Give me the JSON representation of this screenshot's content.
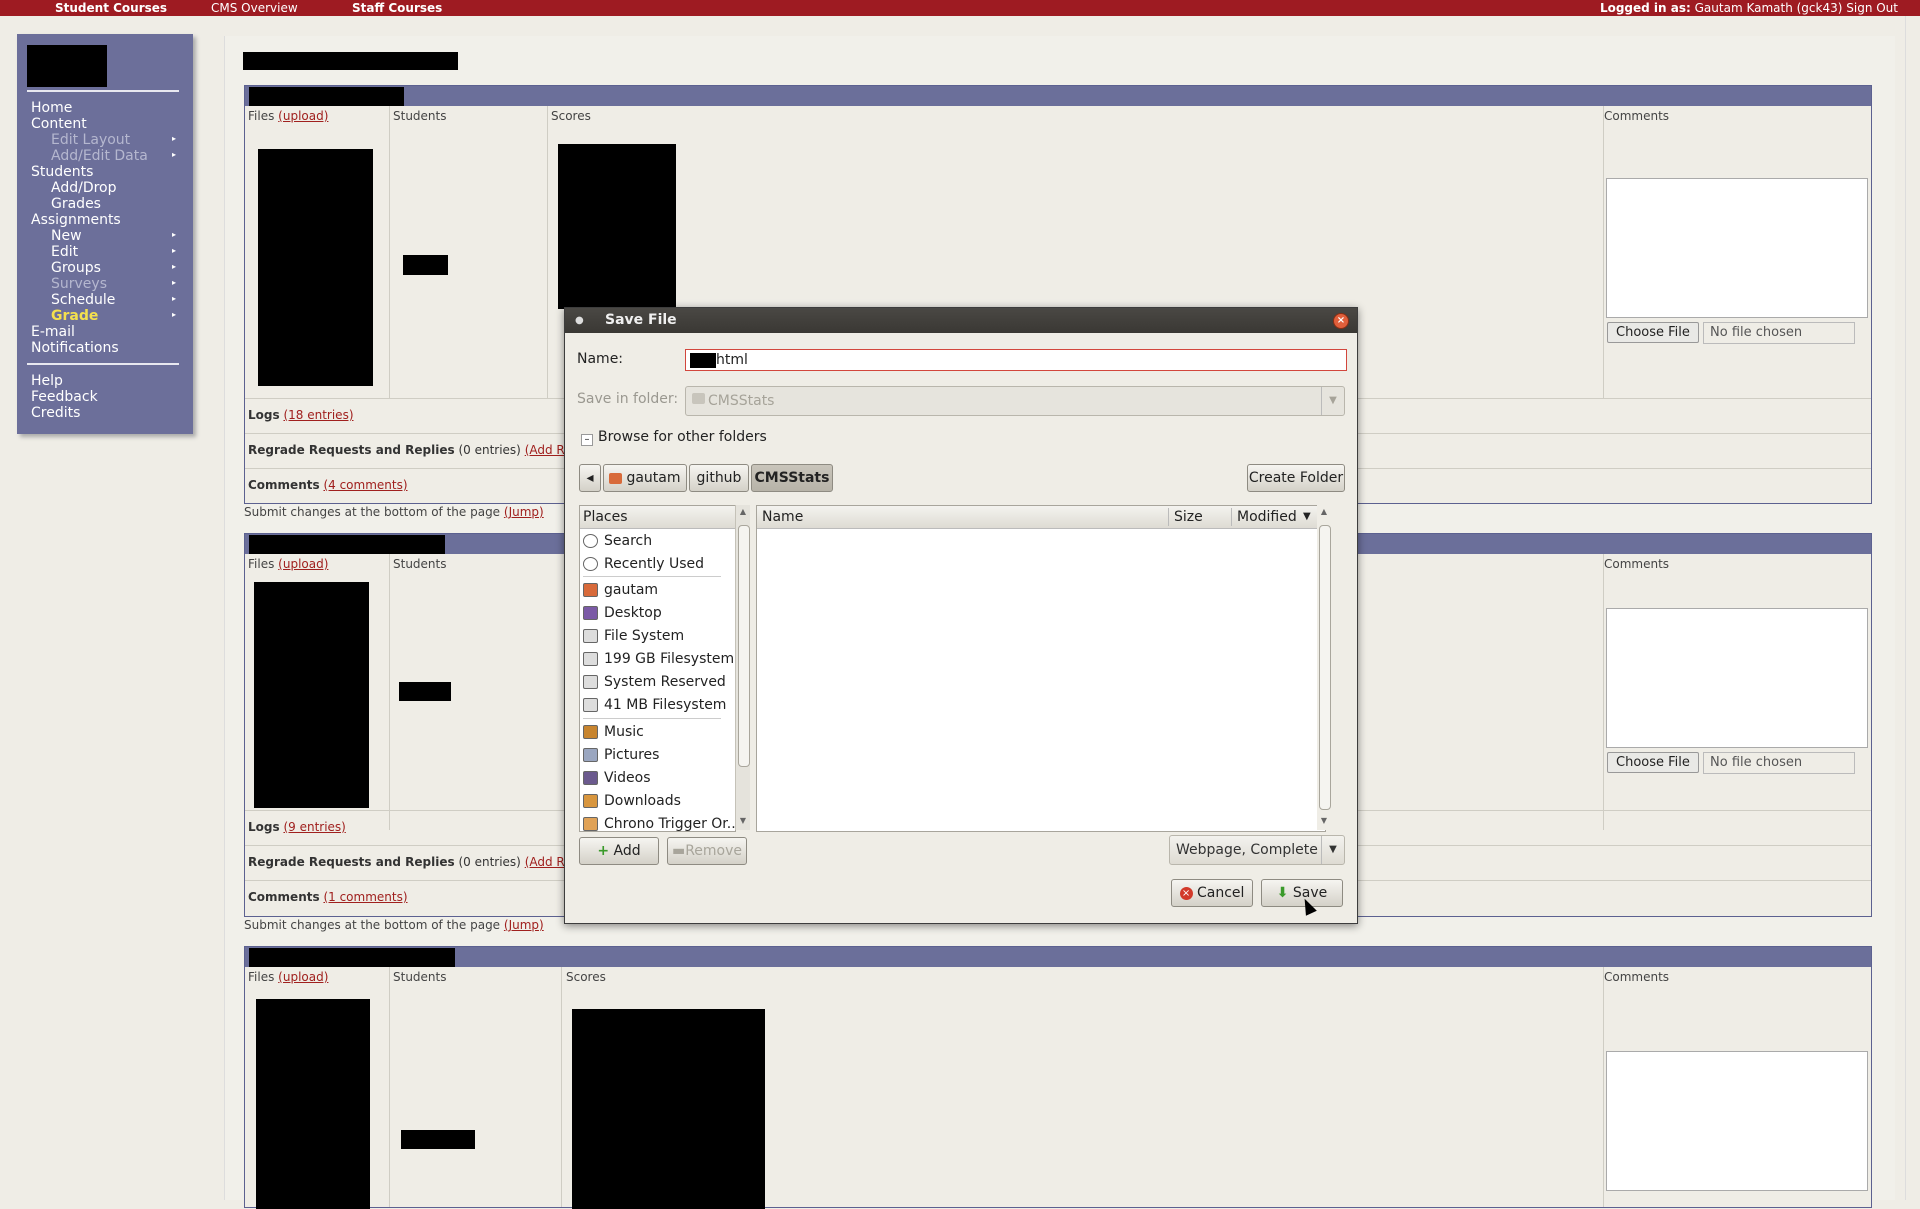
{
  "topbar": {
    "student_courses": "Student Courses",
    "cms_overview": "CMS Overview",
    "staff_courses": "Staff Courses",
    "logged_in_label": "Logged in as:",
    "user": "Gautam Kamath (gck43)",
    "sign_out": "Sign Out"
  },
  "sidebar": {
    "home": "Home",
    "content": "Content",
    "edit_layout": "Edit Layout",
    "add_edit_data": "Add/Edit Data",
    "students": "Students",
    "add_drop": "Add/Drop",
    "grades": "Grades",
    "assignments": "Assignments",
    "new": "New",
    "edit": "Edit",
    "groups": "Groups",
    "surveys": "Surveys",
    "schedule": "Schedule",
    "grade": "Grade",
    "email": "E-mail",
    "notifications": "Notifications",
    "help": "Help",
    "feedback": "Feedback",
    "credits": "Credits"
  },
  "columns": {
    "files": "Files",
    "upload": "(upload)",
    "students": "Students",
    "scores": "Scores",
    "comments": "Comments"
  },
  "panels": [
    {
      "logs_label": "Logs",
      "logs_count": "(18 entries)",
      "regrade_label": "Regrade Requests and Replies",
      "regrade_count": "(0 entries)",
      "add_request": "(Add Request)",
      "comments_label": "Comments",
      "comments_count": "(4 comments)"
    },
    {
      "logs_label": "Logs",
      "logs_count": "(9 entries)",
      "regrade_label": "Regrade Requests and Replies",
      "regrade_count": "(0 entries)",
      "add_request": "(Add Request)",
      "comments_label": "Comments",
      "comments_count": "(1 comments)"
    }
  ],
  "submit_note": "Submit changes at the bottom of the page",
  "jump": "(Jump)",
  "file_input": {
    "choose": "Choose File",
    "status": "No file chosen"
  },
  "dialog": {
    "title": "Save File",
    "name_label": "Name:",
    "name_value": "html",
    "save_in_label": "Save in folder:",
    "save_in_value": "CMSStats",
    "browse_label": "Browse for other folders",
    "breadcrumbs": [
      "gautam",
      "github",
      "CMSStats"
    ],
    "create_folder": "Create Folder",
    "places_header": "Places",
    "places": [
      {
        "label": "Search",
        "icon": "search-icon"
      },
      {
        "label": "Recently Used",
        "icon": "clock-icon"
      },
      {
        "label": "gautam",
        "icon": "home-folder-icon"
      },
      {
        "label": "Desktop",
        "icon": "desktop-icon"
      },
      {
        "label": "File System",
        "icon": "drive-icon"
      },
      {
        "label": "199 GB Filesystem",
        "icon": "drive-icon"
      },
      {
        "label": "System Reserved",
        "icon": "drive-icon"
      },
      {
        "label": "41 MB Filesystem",
        "icon": "drive-icon"
      },
      {
        "label": "Music",
        "icon": "music-folder-icon"
      },
      {
        "label": "Pictures",
        "icon": "pictures-folder-icon"
      },
      {
        "label": "Videos",
        "icon": "videos-folder-icon"
      },
      {
        "label": "Downloads",
        "icon": "downloads-folder-icon"
      },
      {
        "label": "Chrono Trigger Or...",
        "icon": "folder-icon"
      }
    ],
    "col_name": "Name",
    "col_size": "Size",
    "col_modified": "Modified",
    "add": "Add",
    "remove": "Remove",
    "file_type": "Webpage, Complete",
    "cancel": "Cancel",
    "save": "Save"
  },
  "colors": {
    "topbar": "#9e1b22",
    "sidebar": "#6c6f9a",
    "active_link": "#f4e04d",
    "link": "#a0201e"
  }
}
